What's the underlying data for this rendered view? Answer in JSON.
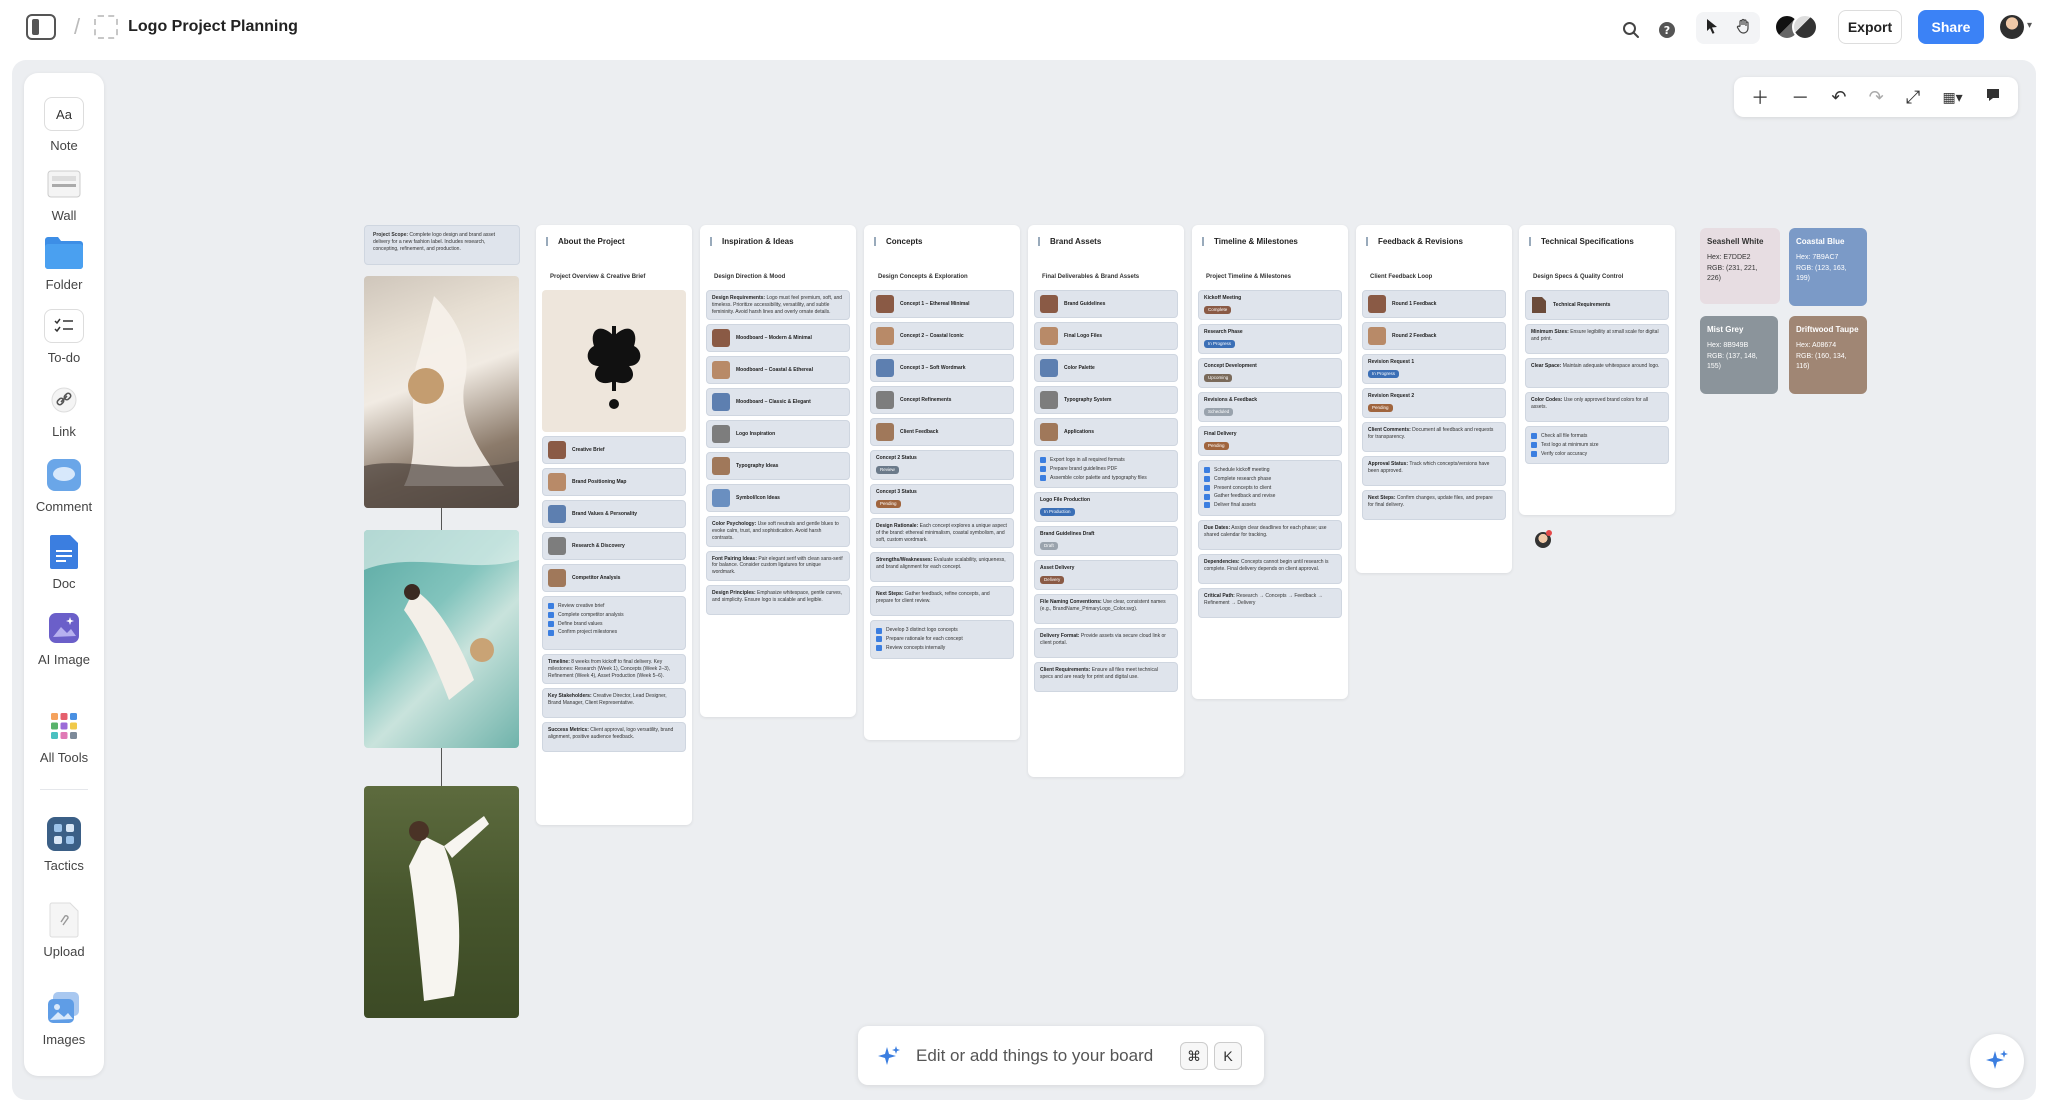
{
  "header": {
    "title": "Logo Project Planning",
    "export_label": "Export",
    "share_label": "Share"
  },
  "toolbar": {
    "items": [
      {
        "label": "Note",
        "glyph": "Aa"
      },
      {
        "label": "Wall"
      },
      {
        "label": "Folder"
      },
      {
        "label": "To-do"
      },
      {
        "label": "Link"
      },
      {
        "label": "Comment"
      },
      {
        "label": "Doc"
      },
      {
        "label": "AI Image"
      },
      {
        "label": "All Tools"
      },
      {
        "label": "Tactics"
      },
      {
        "label": "Upload"
      },
      {
        "label": "Images"
      }
    ]
  },
  "board": {
    "scope_label": "Project Scope:",
    "scope_text": "Complete logo design and brand asset delivery for a new fashion label. Includes research, concepting, refinement, and production.",
    "columns": [
      {
        "title": "About the Project",
        "subtitle": "Project Overview & Creative Brief"
      },
      {
        "title": "Inspiration & Ideas",
        "subtitle": "Design Direction & Mood"
      },
      {
        "title": "Concepts",
        "subtitle": "Design Concepts & Exploration"
      },
      {
        "title": "Brand Assets",
        "subtitle": "Final Deliverables & Brand Assets"
      },
      {
        "title": "Timeline & Milestones",
        "subtitle": "Project Timeline & Milestones"
      },
      {
        "title": "Feedback & Revisions",
        "subtitle": "Client Feedback Loop"
      },
      {
        "title": "Technical Specifications",
        "subtitle": "Design Specs & Quality Control"
      }
    ],
    "about_cards": [
      "Creative Brief",
      "Brand Positioning Map",
      "Brand Values & Personality",
      "Research & Discovery",
      "Competitor Analysis"
    ],
    "about_tasks": [
      "Review creative brief",
      "Complete competitor analysis",
      "Define brand values",
      "Confirm project milestones"
    ],
    "about_notes": [
      {
        "label": "Timeline:",
        "text": "8 weeks from kickoff to final delivery. Key milestones: Research (Week 1), Concepts (Week 2–3), Refinement (Week 4), Asset Production (Week 5–6)."
      },
      {
        "label": "Key Stakeholders:",
        "text": "Creative Director, Lead Designer, Brand Manager, Client Representative."
      },
      {
        "label": "Success Metrics:",
        "text": "Client approval, logo versatility, brand alignment, positive audience feedback."
      }
    ],
    "inspiration_top": {
      "label": "Design Requirements:",
      "text": "Logo must feel premium, soft, and timeless. Prioritize accessibility, versatility, and subtle femininity. Avoid harsh lines and overly ornate details."
    },
    "inspiration_cards": [
      "Moodboard – Modern & Minimal",
      "Moodboard – Coastal & Ethereal",
      "Moodboard – Classic & Elegant",
      "Logo Inspiration",
      "Typography Ideas",
      "Symbol/Icon Ideas"
    ],
    "inspiration_notes": [
      {
        "label": "Color Psychology:",
        "text": "Use soft neutrals and gentle blues to evoke calm, trust, and sophistication. Avoid harsh contrasts."
      },
      {
        "label": "Font Pairing Ideas:",
        "text": "Pair elegant serif with clean sans-serif for balance. Consider custom ligatures for unique wordmark."
      },
      {
        "label": "Design Principles:",
        "text": "Emphasize whitespace, gentle curves, and simplicity. Ensure logo is scalable and legible."
      }
    ],
    "concept_cards": [
      "Concept 1 – Ethereal Minimal",
      "Concept 2 – Coastal Iconic",
      "Concept 3 – Soft Wordmark",
      "Concept Refinements",
      "Client Feedback"
    ],
    "concept_status": [
      {
        "label": "Concept 2 Status",
        "badge": "Review"
      },
      {
        "label": "Concept 3 Status",
        "badge": "Pending"
      }
    ],
    "concept_notes": [
      {
        "label": "Design Rationale:",
        "text": "Each concept explores a unique aspect of the brand: ethereal minimalism, coastal symbolism, and soft, custom wordmark."
      },
      {
        "label": "Strengths/Weaknesses:",
        "text": "Evaluate scalability, uniqueness, and brand alignment for each concept."
      },
      {
        "label": "Next Steps:",
        "text": "Gather feedback, refine concepts, and prepare for client review."
      }
    ],
    "concept_tasks": [
      "Develop 3 distinct logo concepts",
      "Prepare rationale for each concept",
      "Review concepts internally"
    ],
    "asset_cards": [
      "Brand Guidelines",
      "Final Logo Files",
      "Color Palette",
      "Typography System",
      "Applications"
    ],
    "asset_tasks": [
      "Export logo in all required formats",
      "Prepare brand guidelines PDF",
      "Assemble color palette and typography files"
    ],
    "asset_status": [
      {
        "label": "Logo File Production",
        "badge": "In Production"
      },
      {
        "label": "Brand Guidelines Draft",
        "badge": "Draft"
      },
      {
        "label": "Asset Delivery",
        "badge": "Delivery"
      }
    ],
    "asset_notes": [
      {
        "label": "File Naming Conventions:",
        "text": "Use clear, consistent names (e.g., BrandName_PrimaryLogo_Color.svg)."
      },
      {
        "label": "Delivery Format:",
        "text": "Provide assets via secure cloud link or client portal."
      },
      {
        "label": "Client Requirements:",
        "text": "Ensure all files meet technical specs and are ready for print and digital use."
      }
    ],
    "timeline_status": [
      {
        "label": "Kickoff Meeting",
        "badge": "Complete"
      },
      {
        "label": "Research Phase",
        "badge": "In Progress"
      },
      {
        "label": "Concept Development",
        "badge": "Upcoming"
      },
      {
        "label": "Revisions & Feedback",
        "badge": "Scheduled"
      },
      {
        "label": "Final Delivery",
        "badge": "Pending"
      }
    ],
    "timeline_tasks": [
      "Schedule kickoff meeting",
      "Complete research phase",
      "Present concepts to client",
      "Gather feedback and revise",
      "Deliver final assets"
    ],
    "timeline_notes": [
      {
        "label": "Due Dates:",
        "text": "Assign clear deadlines for each phase; use shared calendar for tracking."
      },
      {
        "label": "Dependencies:",
        "text": "Concepts cannot begin until research is complete. Final delivery depends on client approval."
      },
      {
        "label": "Critical Path:",
        "text": "Research → Concepts → Feedback → Refinement → Delivery"
      }
    ],
    "feedback_cards": [
      "Round 1 Feedback",
      "Round 2 Feedback"
    ],
    "feedback_status": [
      {
        "label": "Revision Request 1",
        "badge": "In Progress"
      },
      {
        "label": "Revision Request 2",
        "badge": "Pending"
      }
    ],
    "feedback_notes": [
      {
        "label": "Client Comments:",
        "text": "Document all feedback and requests for transparency."
      },
      {
        "label": "Approval Status:",
        "text": "Track which concepts/versions have been approved."
      },
      {
        "label": "Next Steps:",
        "text": "Confirm changes, update files, and prepare for final delivery."
      }
    ],
    "tech_card": "Technical Requirements",
    "tech_notes": [
      {
        "label": "Minimum Sizes:",
        "text": "Ensure legibility at small scale for digital and print."
      },
      {
        "label": "Clear Space:",
        "text": "Maintain adequate whitespace around logo."
      },
      {
        "label": "Color Codes:",
        "text": "Use only approved brand colors for all assets."
      }
    ],
    "tech_tasks": [
      "Check all file formats",
      "Test logo at minimum size",
      "Verify color accuracy"
    ],
    "swatches": [
      {
        "name": "Seashell White",
        "hex": "Hex: E7DDE2",
        "rgb": "RGB: (231, 221, 226)",
        "color": "#e7dde2",
        "text_color": "#333333"
      },
      {
        "name": "Coastal Blue",
        "hex": "Hex: 7B9AC7",
        "rgb": "RGB: (123, 163, 199)",
        "color": "#7b9ac7",
        "text_color": "#ffffff"
      },
      {
        "name": "Mist Grey",
        "hex": "Hex: 8B949B",
        "rgb": "RGB: (137, 148, 155)",
        "color": "#8b949b",
        "text_color": "#ffffff"
      },
      {
        "name": "Driftwood Taupe",
        "hex": "Hex: A08674",
        "rgb": "RGB: (160, 134, 116)",
        "color": "#a08674",
        "text_color": "#ffffff"
      }
    ]
  },
  "ai_bar": {
    "placeholder": "Edit or add things to your board",
    "key1": "⌘",
    "key2": "K"
  },
  "colors": {
    "accent": "#3b82f6",
    "canvas": "#eceef1"
  }
}
